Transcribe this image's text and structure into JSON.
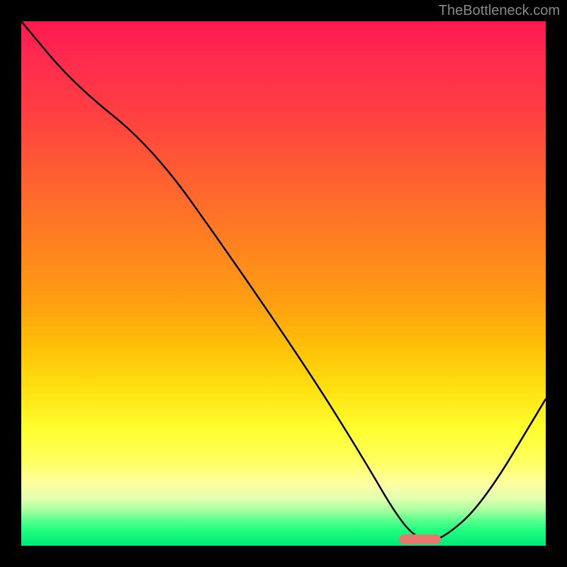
{
  "watermark": "TheBottleneck.com",
  "chart_data": {
    "type": "line",
    "title": "",
    "xlabel": "",
    "ylabel": "",
    "xlim": [
      0,
      100
    ],
    "ylim": [
      0,
      100
    ],
    "grid": false,
    "legend": false,
    "series": [
      {
        "name": "bottleneck-curve",
        "x": [
          0,
          10,
          25,
          40,
          55,
          65,
          72,
          76,
          80,
          88,
          100
        ],
        "y": [
          100,
          88,
          76,
          55,
          33,
          17,
          5,
          1,
          1,
          8,
          28
        ]
      }
    ],
    "marker": {
      "x_start": 72,
      "x_end": 80,
      "y": 0.5,
      "color": "#e8776e"
    },
    "background_gradient": {
      "orientation": "vertical",
      "stops": [
        {
          "pos": 0.0,
          "color": "#ff1850"
        },
        {
          "pos": 0.5,
          "color": "#ffa010"
        },
        {
          "pos": 0.8,
          "color": "#ffff30"
        },
        {
          "pos": 1.0,
          "color": "#00e878"
        }
      ]
    }
  }
}
